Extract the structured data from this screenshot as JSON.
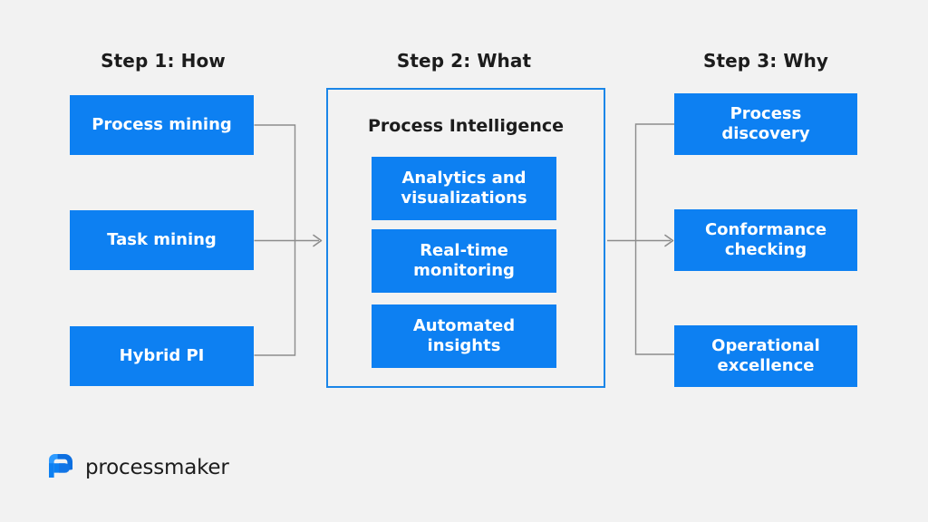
{
  "background_color": "#f2f2f2",
  "accent_color": "#0d80f2",
  "panel_border_color": "#1b86e8",
  "connector_color": "#8c8c8c",
  "headings": {
    "step1": "Step 1: How",
    "step2": "Step 2: What",
    "step3": "Step 3: Why"
  },
  "left_column": {
    "boxes": [
      {
        "label": "Process mining"
      },
      {
        "label": "Task mining"
      },
      {
        "label": "Hybrid PI"
      }
    ]
  },
  "center_panel": {
    "title": "Process Intelligence",
    "boxes": [
      {
        "label": "Analytics and\nvisualizations"
      },
      {
        "label": "Real-time\nmonitoring"
      },
      {
        "label": "Automated\ninsights"
      }
    ]
  },
  "right_column": {
    "boxes": [
      {
        "label": "Process\ndiscovery"
      },
      {
        "label": "Conformance\nchecking"
      },
      {
        "label": "Operational\nexcellence"
      }
    ]
  },
  "logo": {
    "mark": "processmaker-logo-icon",
    "wordmark": "processmaker"
  }
}
